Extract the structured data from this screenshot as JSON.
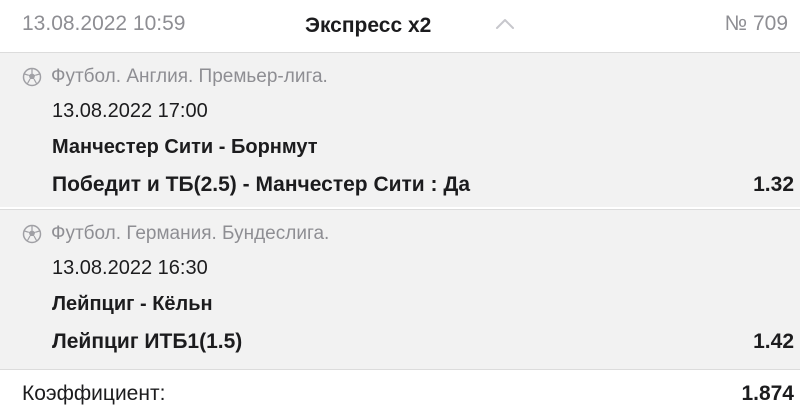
{
  "header": {
    "date": "13.08.2022 10:59",
    "title": "Экспресс x2",
    "number": "№ 709",
    "chevron_icon": "chevron-up-icon"
  },
  "events": [
    {
      "sport_icon": "soccer-ball-icon",
      "league": "Футбол. Англия. Премьер-лига.",
      "datetime": "13.08.2022 17:00",
      "teams": "Манчестер Сити - Борнмут",
      "bet": "Победит и ТБ(2.5) - Манчестер Сити : Да",
      "odd": "1.32"
    },
    {
      "sport_icon": "soccer-ball-icon",
      "league": "Футбол. Германия. Бундеслига.",
      "datetime": "13.08.2022 16:30",
      "teams": "Лейпциг - Кёльн",
      "bet": "Лейпциг ИТБ1(1.5)",
      "odd": "1.42"
    }
  ],
  "summary": {
    "label": "Коэффициент:",
    "value": "1.874"
  },
  "colors": {
    "event_background": "#f2f2f2",
    "secondary_text": "#8e8e93",
    "primary_text": "#1c1c1e"
  }
}
